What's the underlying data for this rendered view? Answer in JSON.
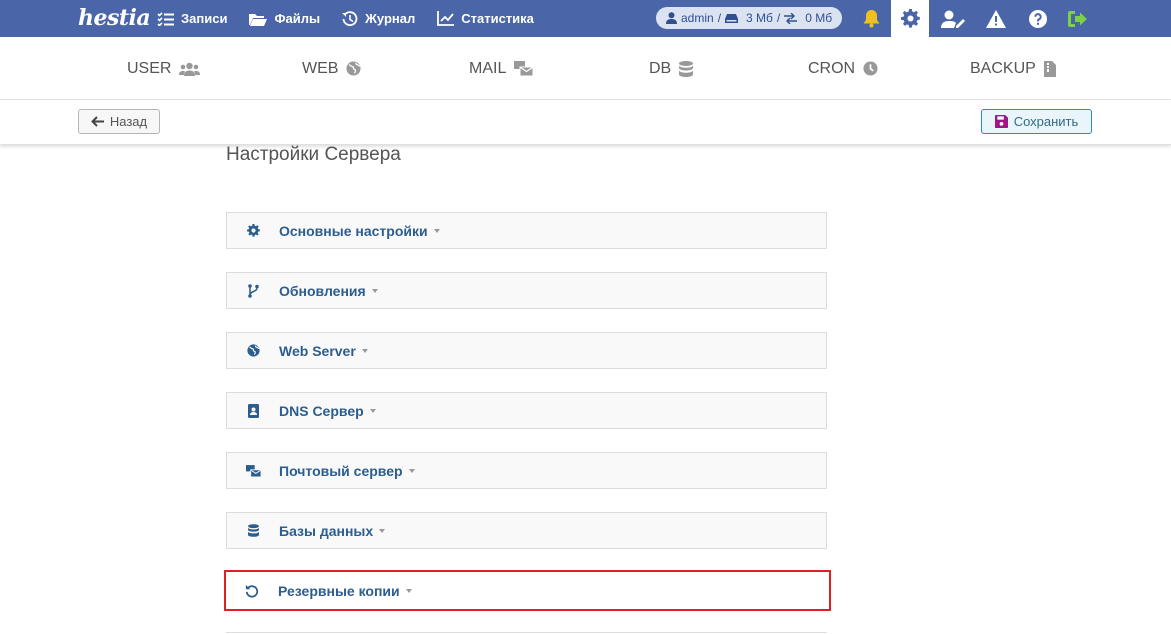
{
  "brand": {
    "logo_text": "hestia"
  },
  "topnav": {
    "items": [
      {
        "label": "Записи",
        "icon": "list-check-icon"
      },
      {
        "label": "Файлы",
        "icon": "folder-open-icon"
      },
      {
        "label": "Журнал",
        "icon": "history-icon"
      },
      {
        "label": "Статистика",
        "icon": "chart-line-icon"
      }
    ]
  },
  "user_status": {
    "username": "admin",
    "separator": "/",
    "disk_usage": "3 Мб",
    "bandwidth_usage": "0 Мб"
  },
  "colors": {
    "topbar": "#4a66a8",
    "bell": "#f0c020",
    "logout": "#7bd148",
    "accent_link": "#2c5d8f",
    "highlight_border": "#e02020"
  },
  "tabs": [
    {
      "label": "USER",
      "icon": "users-icon"
    },
    {
      "label": "WEB",
      "icon": "globe-icon"
    },
    {
      "label": "MAIL",
      "icon": "mail-bulk-icon"
    },
    {
      "label": "DB",
      "icon": "database-icon"
    },
    {
      "label": "CRON",
      "icon": "clock-icon"
    },
    {
      "label": "BACKUP",
      "icon": "file-zipper-icon"
    }
  ],
  "toolbar": {
    "back_label": "Назад",
    "save_label": "Сохранить"
  },
  "page": {
    "title": "Настройки Сервера"
  },
  "sections": [
    {
      "label": "Основные настройки",
      "icon": "gear-icon"
    },
    {
      "label": "Обновления",
      "icon": "code-branch-icon"
    },
    {
      "label": "Web Server",
      "icon": "globe-icon"
    },
    {
      "label": "DNS Сервер",
      "icon": "address-book-icon"
    },
    {
      "label": "Почтовый сервер",
      "icon": "mail-bulk-icon"
    },
    {
      "label": "Базы данных",
      "icon": "database-icon"
    },
    {
      "label": "Резервные копии",
      "icon": "rotate-left-icon",
      "highlighted": true
    }
  ]
}
